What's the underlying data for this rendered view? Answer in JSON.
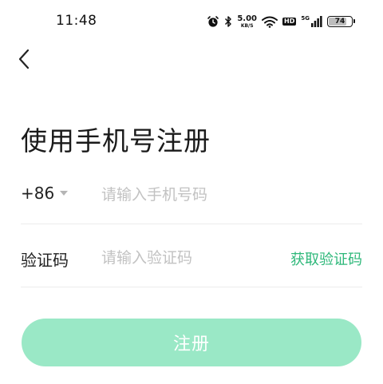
{
  "status_bar": {
    "time": "11:48",
    "net_speed_value": "5.00",
    "net_speed_unit": "KB/S",
    "hd_label": "HD",
    "signal_label": "5G",
    "battery_level": "74",
    "icons": [
      "alarm-icon",
      "bluetooth-icon",
      "wifi-icon",
      "signal-icon",
      "battery-icon"
    ]
  },
  "nav": {
    "back_icon": "chevron-left-icon"
  },
  "title": "使用手机号注册",
  "phone_row": {
    "country_code": "+86",
    "placeholder": "请输入手机号码",
    "value": ""
  },
  "code_row": {
    "label": "验证码",
    "placeholder": "请输入验证码",
    "value": "",
    "get_code_label": "获取验证码"
  },
  "register_button": {
    "label": "注册"
  },
  "colors": {
    "accent": "#2eb87a",
    "button_disabled_bg": "#9ae8c6",
    "placeholder": "#c2c2c2",
    "divider": "#ececec"
  }
}
